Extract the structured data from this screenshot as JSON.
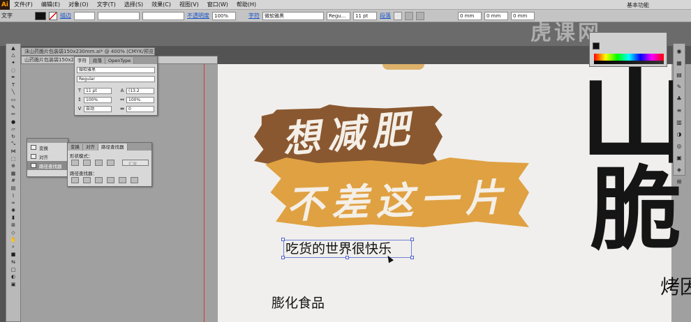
{
  "app": {
    "logo": "Ai",
    "workspace": "基本功能"
  },
  "menu": [
    "文件(F)",
    "编辑(E)",
    "对象(O)",
    "文字(T)",
    "选择(S)",
    "效果(C)",
    "视图(V)",
    "窗口(W)",
    "帮助(H)"
  ],
  "control": {
    "mode_label": "文字",
    "stroke_label": "描边",
    "opacity_link": "不透明度",
    "opacity_value": "100%",
    "char_link": "字符",
    "font": "微软雅黑",
    "style": "Regu...",
    "size": "11 pt",
    "para_link": "段落",
    "indent_1": "0 mm",
    "indent_2": "0 mm",
    "indent_3": "0 mm"
  },
  "doc_tabs": [
    "沫山药脆片包装袋150x230mm.ai* @ 400% (CMYK/预览)",
    "山药脆片包装袋150x230mm.ai* @ 166% (CMYK/预览)"
  ],
  "char_panel": {
    "tabs": [
      "字符",
      "段落",
      "OpenType"
    ],
    "font": "微软雅黑",
    "style": "Regular",
    "size": "11 pt",
    "leading": "(13.2",
    "h_scale": "100%",
    "v_scale": "100%",
    "kerning": "自动",
    "tracking": "0"
  },
  "side_panel": {
    "items": [
      "变换",
      "对齐",
      "路径查找器"
    ]
  },
  "pathfinder": {
    "tabs": [
      "变换",
      "对齐",
      "路径查找器"
    ],
    "shape_modes_label": "形状模式：",
    "expand_label": "扩展",
    "pathfinders_label": "路径查找器："
  },
  "canvas": {
    "headline_1": "想减肥",
    "headline_2": "不差这一片",
    "selected_text": "吃货的世界很快乐",
    "text_2": "膨化食品",
    "text_3": "烤因",
    "big_1": "山",
    "big_2": "脆"
  },
  "watermark": "虎课网",
  "colors": {
    "brown": "#8a5830",
    "orange": "#e0a142",
    "selection": "#4d5fd0",
    "bleed": "#e0322e"
  }
}
